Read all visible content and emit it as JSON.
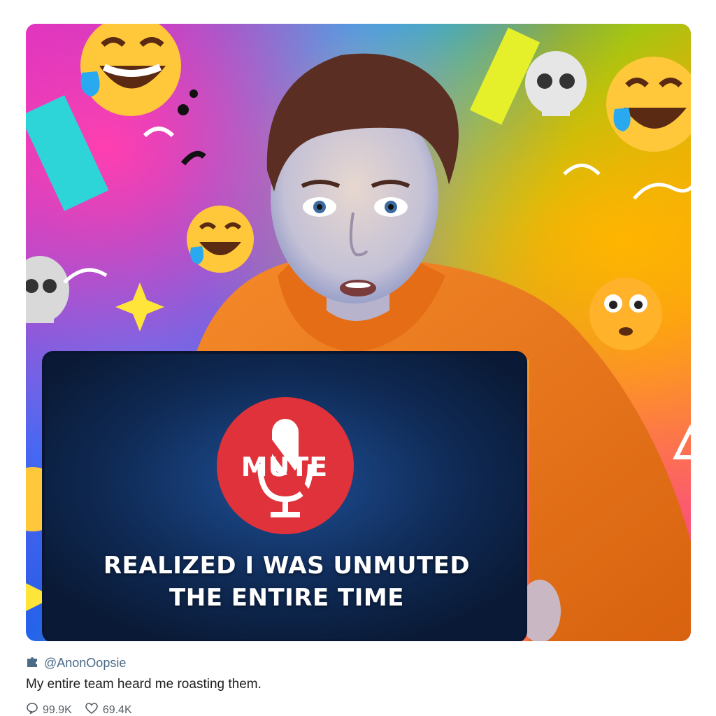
{
  "post": {
    "handle": "@AnonOopsie",
    "caption": "My entire team heard me roasting them.",
    "replies_count": "99.9K",
    "likes_count": "69.4K"
  },
  "image": {
    "mute_label": "MUTE",
    "headline_line1": "REALIZED I WAS UNMUTED",
    "headline_line2": "THE ENTIRE TIME"
  },
  "icons": {
    "avatar": "puzzle-avatar-icon",
    "reply": "speech-bubble-icon",
    "like": "heart-icon",
    "mic": "muted-microphone-icon"
  },
  "colors": {
    "hoodie": "#f07a1e",
    "laptop": "#0f2446",
    "mute_badge": "#e0323a",
    "handle": "#4a6a88"
  }
}
